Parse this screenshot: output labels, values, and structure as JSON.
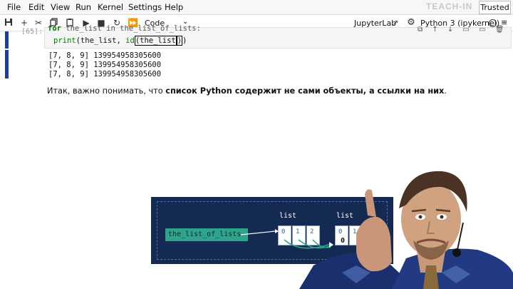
{
  "menubar": {
    "items": [
      "File",
      "Edit",
      "View",
      "Run",
      "Kernel",
      "Settings",
      "Help"
    ],
    "watermark": "TEACH-IN",
    "trusted": "Trusted"
  },
  "toolbar": {
    "cell_type": "Code",
    "jupyterlab_label": "JupyterLab",
    "kernel_label": "Python 3 (ipykernel)"
  },
  "cell": {
    "prompt": "[65]:",
    "code_line1_kw": "for",
    "code_line1_rest": " the_list in the_list_of_lists:",
    "code_line2_fn": "print",
    "code_line2_a": "(the_list, ",
    "code_line2_fn2": "id",
    "code_line2_b": "(the_list",
    "code_line2_c": ")",
    "code_line2_d": ")",
    "outputs": [
      "[7, 8, 9] 139954958305600",
      "[7, 8, 9] 139954958305600",
      "[7, 8, 9] 139954958305600"
    ]
  },
  "markdown": {
    "prefix": "Итак, важно понимать, что ",
    "bold": "список Python содержит не сами объекты, а ссылки на них",
    "suffix": "."
  },
  "diagram": {
    "variable": "the_list_of_lists",
    "list1_label": "list",
    "list1_cells": [
      "0",
      "1",
      "2"
    ],
    "list2_label": "list",
    "list2_cells": [
      "0",
      "1"
    ],
    "list2_extra": "0"
  },
  "colors": {
    "accent": "#1a3fa0",
    "diagram_bg": "#152a52",
    "var_box": "#2ea58a"
  }
}
